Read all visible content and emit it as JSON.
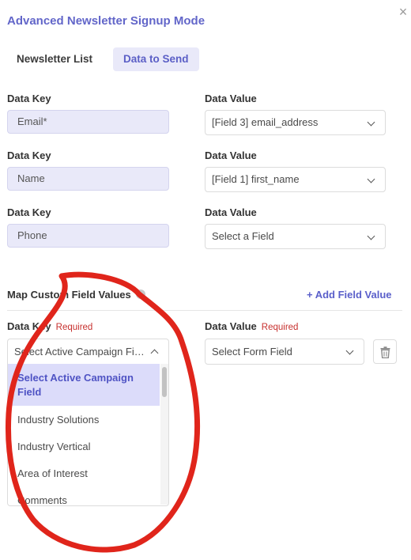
{
  "modal": {
    "title": "Advanced Newsletter Signup Mode",
    "close_glyph": "×"
  },
  "tabs": [
    {
      "label": "Newsletter List",
      "active": false
    },
    {
      "label": "Data to Send",
      "active": true
    }
  ],
  "mapping": {
    "key_label": "Data Key",
    "value_label": "Data Value",
    "rows": [
      {
        "key": "Email*",
        "value": "[Field 3] email_address"
      },
      {
        "key": "Name",
        "value": "[Field 1] first_name"
      },
      {
        "key": "Phone",
        "value": "Select a Field"
      }
    ]
  },
  "custom": {
    "section_title": "Map Custom Field Values",
    "add_link": "+ Add Field Value",
    "key_label": "Data Key",
    "value_label": "Data Value",
    "required": "Required",
    "key_select_value": "Select Active Campaign Field",
    "value_select_value": "Select Form Field",
    "options": [
      "Select Active Campaign Field",
      "Industry Solutions",
      "Industry Vertical",
      "Area of Interest",
      "Comments"
    ]
  },
  "colors": {
    "accent": "#6266c9",
    "required": "#c7302e",
    "annotation": "#e0251b"
  },
  "icons": {
    "close": "close-icon",
    "chevron": "chevron-down-icon",
    "delete": "trash-icon"
  }
}
